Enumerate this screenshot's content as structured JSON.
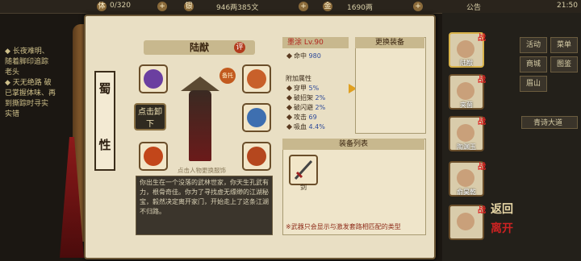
{
  "topbar": {
    "stamina": "0/320",
    "silver": "946两385文",
    "gold": "1690两",
    "notice": "公告",
    "time": "21:50"
  },
  "chat": [
    "◆ 长夜难明、",
    "随着脚印追踪",
    "老头",
    "◆ 天无绝路 破",
    "已掌握体味、再",
    "到撕踪时寻实",
    "实错"
  ],
  "faction": [
    "蜀",
    "性"
  ],
  "character": {
    "name": "陆猷",
    "eval_label": "评",
    "spare_label": "备托",
    "unequip_label": "点击卸下",
    "hint": "点击人物更换服饰",
    "description": "你出生在一个没落的武林世家，你天生孔武有力，根骨奇佳。你为了寻找虚无缥缈的江湖秘宝，毅然决定离开家门，开始走上了这条江湖不归路。"
  },
  "stats": {
    "tab": "墨涂 Lv.90",
    "rows": [
      {
        "label": "命中",
        "value": "980"
      }
    ],
    "subhead": "附加属性",
    "extra": [
      {
        "label": "穿甲",
        "value": "5%"
      },
      {
        "label": "破招架",
        "value": "2%"
      },
      {
        "label": "破闪避",
        "value": "2%"
      },
      {
        "label": "攻击",
        "value": "69"
      },
      {
        "label": "吸血",
        "value": "4.4%"
      }
    ]
  },
  "replace": {
    "title": "更换装备"
  },
  "equiplist": {
    "title": "装备列表",
    "item_label": "剑",
    "note": "※武器只会显示与激发套路相匹配的类型"
  },
  "right_menu": {
    "buttons": [
      "活动",
      "菜单",
      "商城",
      "图鉴",
      "眉山"
    ],
    "quest": "青诗大道"
  },
  "roster": [
    {
      "name": "陆猷",
      "cls": "战"
    },
    {
      "name": "夹菌",
      "cls": "战"
    },
    {
      "name": "陶渊玉",
      "cls": "战"
    },
    {
      "name": "俞昊乾",
      "cls": "战"
    },
    {
      "name": "",
      "cls": "战"
    }
  ],
  "back": {
    "label1": "返",
    "label2": "回",
    "label3": "离",
    "label4": "开"
  },
  "colors": {
    "accent": "#b0261e",
    "parchment": "#e9dfc4",
    "stat_value": "#2e4a9a"
  }
}
